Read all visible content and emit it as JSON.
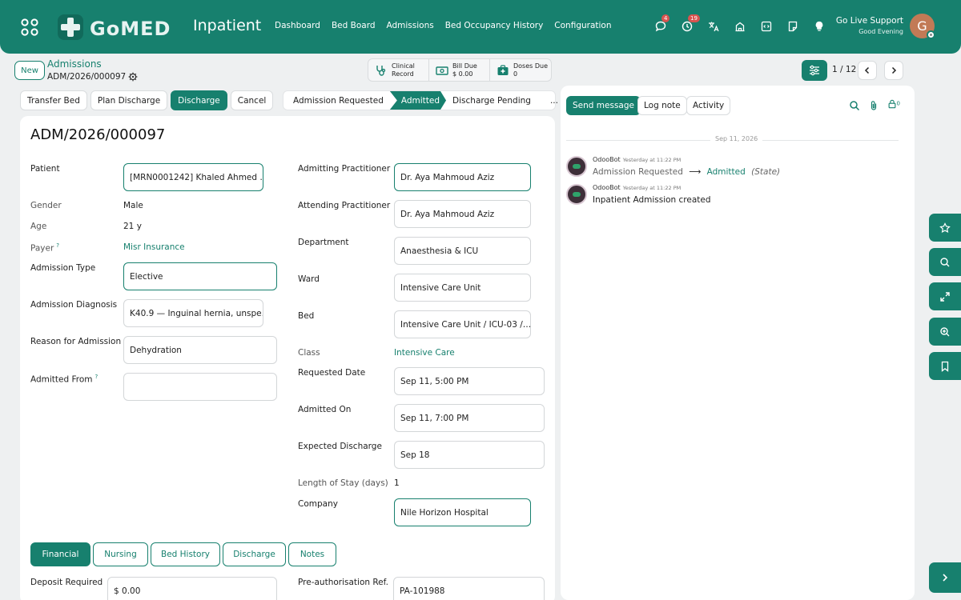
{
  "app": {
    "title": "Inpatient",
    "logo_text": "GoMED",
    "nav": [
      "Dashboard",
      "Bed Board",
      "Admissions",
      "Bed Occupancy History",
      "Configuration"
    ],
    "badges": {
      "messages": "4",
      "activities": "19"
    },
    "support_title": "Go Live Support",
    "support_greeting": "Good Evening",
    "avatar_letter": "G"
  },
  "breadcrumb": {
    "new_label": "New",
    "parent": "Admissions",
    "current": "ADM/2026/000097"
  },
  "stats": [
    {
      "line1": "Clinical",
      "line2": "Record",
      "icon": "stethoscope-icon"
    },
    {
      "line1": "Bill Due",
      "line2": "$ 0.00",
      "icon": "money-icon"
    },
    {
      "line1": "Doses Due",
      "line2": "0",
      "icon": "medkit-icon"
    }
  ],
  "pager": {
    "text": "1 / 12"
  },
  "actions": {
    "transfer": "Transfer Bed",
    "plan": "Plan Discharge",
    "discharge": "Discharge",
    "cancel": "Cancel"
  },
  "status": {
    "stages": [
      "Admission Requested",
      "Admitted",
      "Discharge Pending",
      "..."
    ],
    "active": "Admitted"
  },
  "form": {
    "title": "ADM/2026/000097",
    "left": {
      "patient_label": "Patient",
      "patient": "[MRN0001242] Khaled Ahmed …",
      "gender_label": "Gender",
      "gender": "Male",
      "age_label": "Age",
      "age": "21 y",
      "payer_label": "Payer",
      "payer": "Misr Insurance",
      "type_label": "Admission Type",
      "type": "Elective",
      "diagnosis_label": "Admission Diagnosis",
      "diagnosis": "K40.9 — Inguinal hernia, unspe…",
      "reason_label": "Reason for Admission",
      "reason": "Dehydration",
      "from_label": "Admitted From",
      "from": ""
    },
    "right": {
      "admitting_label": "Admitting Practitioner",
      "admitting": "Dr. Aya Mahmoud Aziz",
      "attending_label": "Attending Practitioner",
      "attending": "Dr. Aya Mahmoud Aziz",
      "department_label": "Department",
      "department": "Anaesthesia & ICU",
      "ward_label": "Ward",
      "ward": "Intensive Care Unit",
      "bed_label": "Bed",
      "bed": "Intensive Care Unit / ICU-03 /…",
      "class_label": "Class",
      "class": "Intensive Care",
      "requested_label": "Requested Date",
      "requested": "Sep 11, 5:00 PM",
      "admitted_label": "Admitted On",
      "admitted": "Sep 11, 7:00 PM",
      "expected_label": "Expected Discharge",
      "expected": "Sep 18",
      "los_label": "Length of Stay (days)",
      "los": "1",
      "company_label": "Company",
      "company": "Nile Horizon Hospital"
    },
    "tabs": [
      "Financial",
      "Nursing",
      "Bed History",
      "Discharge",
      "Notes"
    ],
    "financial": {
      "deposit_label": "Deposit Required",
      "deposit": "$ 0.00",
      "preauth_label": "Pre-authorisation Ref.",
      "preauth": "PA-101988"
    }
  },
  "chatter": {
    "send": "Send message",
    "log": "Log note",
    "activity": "Activity",
    "followers": "0",
    "date": "Sep 11, 2026",
    "messages": [
      {
        "author": "OdooBot",
        "time": "Yesterday at 11:22 PM",
        "old": "Admission Requested",
        "arrow": "⟶",
        "new": "Admitted",
        "field": "(State)"
      },
      {
        "author": "OdooBot",
        "time": "Yesterday at 11:22 PM",
        "body": "Inpatient Admission created"
      }
    ]
  },
  "colors": {
    "accent": "#17806e",
    "badge": "#d9534f"
  }
}
